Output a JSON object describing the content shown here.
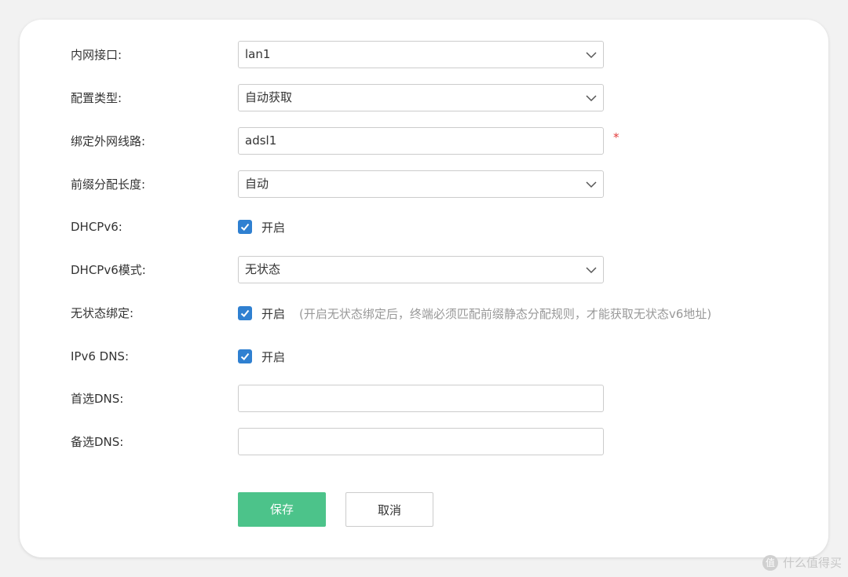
{
  "form": {
    "lan_interface": {
      "label": "内网接口:",
      "value": "lan1"
    },
    "config_type": {
      "label": "配置类型:",
      "value": "自动获取"
    },
    "wan_binding": {
      "label": "绑定外网线路:",
      "value": "adsl1",
      "required_mark": "*"
    },
    "prefix_length": {
      "label": "前缀分配长度:",
      "value": "自动"
    },
    "dhcpv6": {
      "label": "DHCPv6:",
      "checked": true,
      "option_label": "开启"
    },
    "dhcpv6_mode": {
      "label": "DHCPv6模式:",
      "value": "无状态"
    },
    "stateless_binding": {
      "label": "无状态绑定:",
      "checked": true,
      "option_label": "开启",
      "hint": "(开启无状态绑定后，终端必须匹配前缀静态分配规则，才能获取无状态v6地址)"
    },
    "ipv6_dns": {
      "label": "IPv6 DNS:",
      "checked": true,
      "option_label": "开启"
    },
    "primary_dns": {
      "label": "首选DNS:",
      "value": ""
    },
    "secondary_dns": {
      "label": "备选DNS:",
      "value": ""
    }
  },
  "buttons": {
    "save": "保存",
    "cancel": "取消"
  },
  "watermark": {
    "logo_text": "值",
    "text": "什么值得买"
  },
  "colors": {
    "checkbox": "#2f80d1",
    "save_button": "#4cc38a",
    "required": "#e33b3b",
    "hint": "#999999"
  }
}
